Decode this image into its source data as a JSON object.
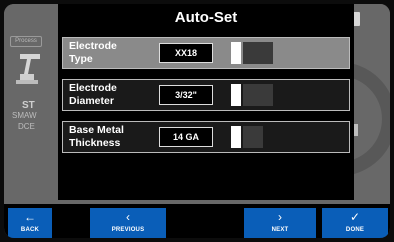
{
  "background": {
    "process_label": "Process",
    "mode_short": "ST",
    "mode_line2": "SMAW",
    "mode_line3": "DCE"
  },
  "dialog": {
    "title": "Auto-Set",
    "rows": [
      {
        "label_line1": "Electrode",
        "label_line2": "Type",
        "value": "XX18",
        "level_filled": 1,
        "level_total": 4,
        "selected": true
      },
      {
        "label_line1": "Electrode",
        "label_line2": "Diameter",
        "value": "3/32\"",
        "level_filled": 1,
        "level_total": 4,
        "selected": false
      },
      {
        "label_line1": "Base Metal",
        "label_line2": "Thickness",
        "value": "14 GA",
        "level_filled": 1,
        "level_total": 4,
        "selected": false
      }
    ]
  },
  "nav": {
    "back": {
      "icon": "arrow-left-icon",
      "label": "BACK"
    },
    "previous": {
      "icon": "chevron-left-icon",
      "label": "PREVIOUS"
    },
    "next": {
      "icon": "chevron-right-icon",
      "label": "NEXT"
    },
    "done": {
      "icon": "checkmark-icon",
      "label": "DONE"
    }
  },
  "colors": {
    "accent_blue": "#0a5eb8",
    "selected_row": "#8a8a8a",
    "dialog_bg": "#000000"
  }
}
